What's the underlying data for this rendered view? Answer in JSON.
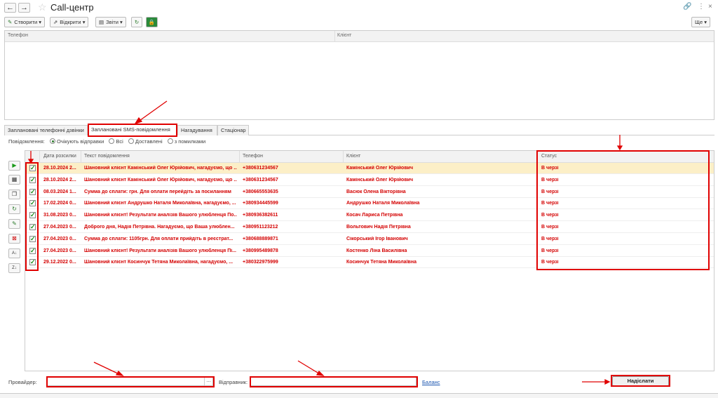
{
  "window": {
    "title": "Call-центр",
    "more_label": "Ще"
  },
  "toolbar": {
    "create": "Створити",
    "open": "Відкрити",
    "reports": "Звіти"
  },
  "upper_table": {
    "col_phone": "Телефон",
    "col_client": "Клієнт"
  },
  "tabs": [
    {
      "label": "Заплановані телефонні дзвінки"
    },
    {
      "label": "Заплановані SMS-повідомлення"
    },
    {
      "label": "Нагадування"
    },
    {
      "label": "Стаціонар"
    }
  ],
  "filter": {
    "label": "Повідомлення:",
    "options": [
      "Очікують відправки",
      "Всі",
      "Доставлені",
      "з помилками"
    ],
    "selected": "Очікують відправки"
  },
  "grid": {
    "columns": {
      "date": "Дата розсилки",
      "text": "Текст повідомлення",
      "phone": "Телефон",
      "client": "Клієнт",
      "status": "Статус"
    },
    "rows": [
      {
        "date": "28.10.2024 2...",
        "text": "Шановний клієнт Камінський Олег Юрійович, нагадуємо, що ...",
        "phone": "+380631234567",
        "client": "Камінський Олег Юрійович",
        "status": "В черзі"
      },
      {
        "date": "28.10.2024 2...",
        "text": "Шановний клієнт Камінський Олег Юрійович, нагадуємо, що ...",
        "phone": "+380631234567",
        "client": "Камінський Олег Юрійович",
        "status": "В черзі"
      },
      {
        "date": "08.03.2024 1...",
        "text": "Сумма до сплати:  грн. Для оплати перейдіть за посиланням",
        "phone": "+380665553635",
        "client": "Васюк Олена Вікторівна",
        "status": "В черзі"
      },
      {
        "date": "17.02.2024 0...",
        "text": "Шановний клієнт Андрушко Наталя Миколаївна, нагадуємо, ...",
        "phone": "+380934445599",
        "client": "Андрушко Наталя Миколаївна",
        "status": "В черзі"
      },
      {
        "date": "31.08.2023 0...",
        "text": "Шановний клієнт! Результати аналізів Вашого улюбленця По...",
        "phone": "+380936382611",
        "client": "Косач Лариса Петрівна",
        "status": "В черзі"
      },
      {
        "date": "27.04.2023 0...",
        "text": "Доброго дня, Надія Петрівна. Нагадуємо, що Ваша улюблен...",
        "phone": "+380951123212",
        "client": "Вольтович Надія Петрівна",
        "status": "В черзі"
      },
      {
        "date": "27.04.2023 0...",
        "text": "Сумма до сплати:  1105грн. Для оплати прийдіть в реєстрат...",
        "phone": "+380688889871",
        "client": "Сікорський Ігор Іванович",
        "status": "В черзі"
      },
      {
        "date": "27.04.2023 0...",
        "text": "Шановний клієнт! Результати аналізів Вашого улюбленця Пі...",
        "phone": "+380995489878",
        "client": "Костенко Ліна Василівна",
        "status": "В черзі"
      },
      {
        "date": "29.12.2022 0...",
        "text": "Шановний клієнт Косинчук Тетяна Миколаївна, нагадуємо, ...",
        "phone": "+380322975999",
        "client": "Косинчук Тетяна Миколаївна",
        "status": "В черзі"
      }
    ]
  },
  "bottom": {
    "provider_label": "Провайдер:",
    "provider_value": "",
    "sender_label": "Відправник:",
    "sender_value": "",
    "balance_link": "Баланс",
    "send_button": "Надіслати"
  }
}
